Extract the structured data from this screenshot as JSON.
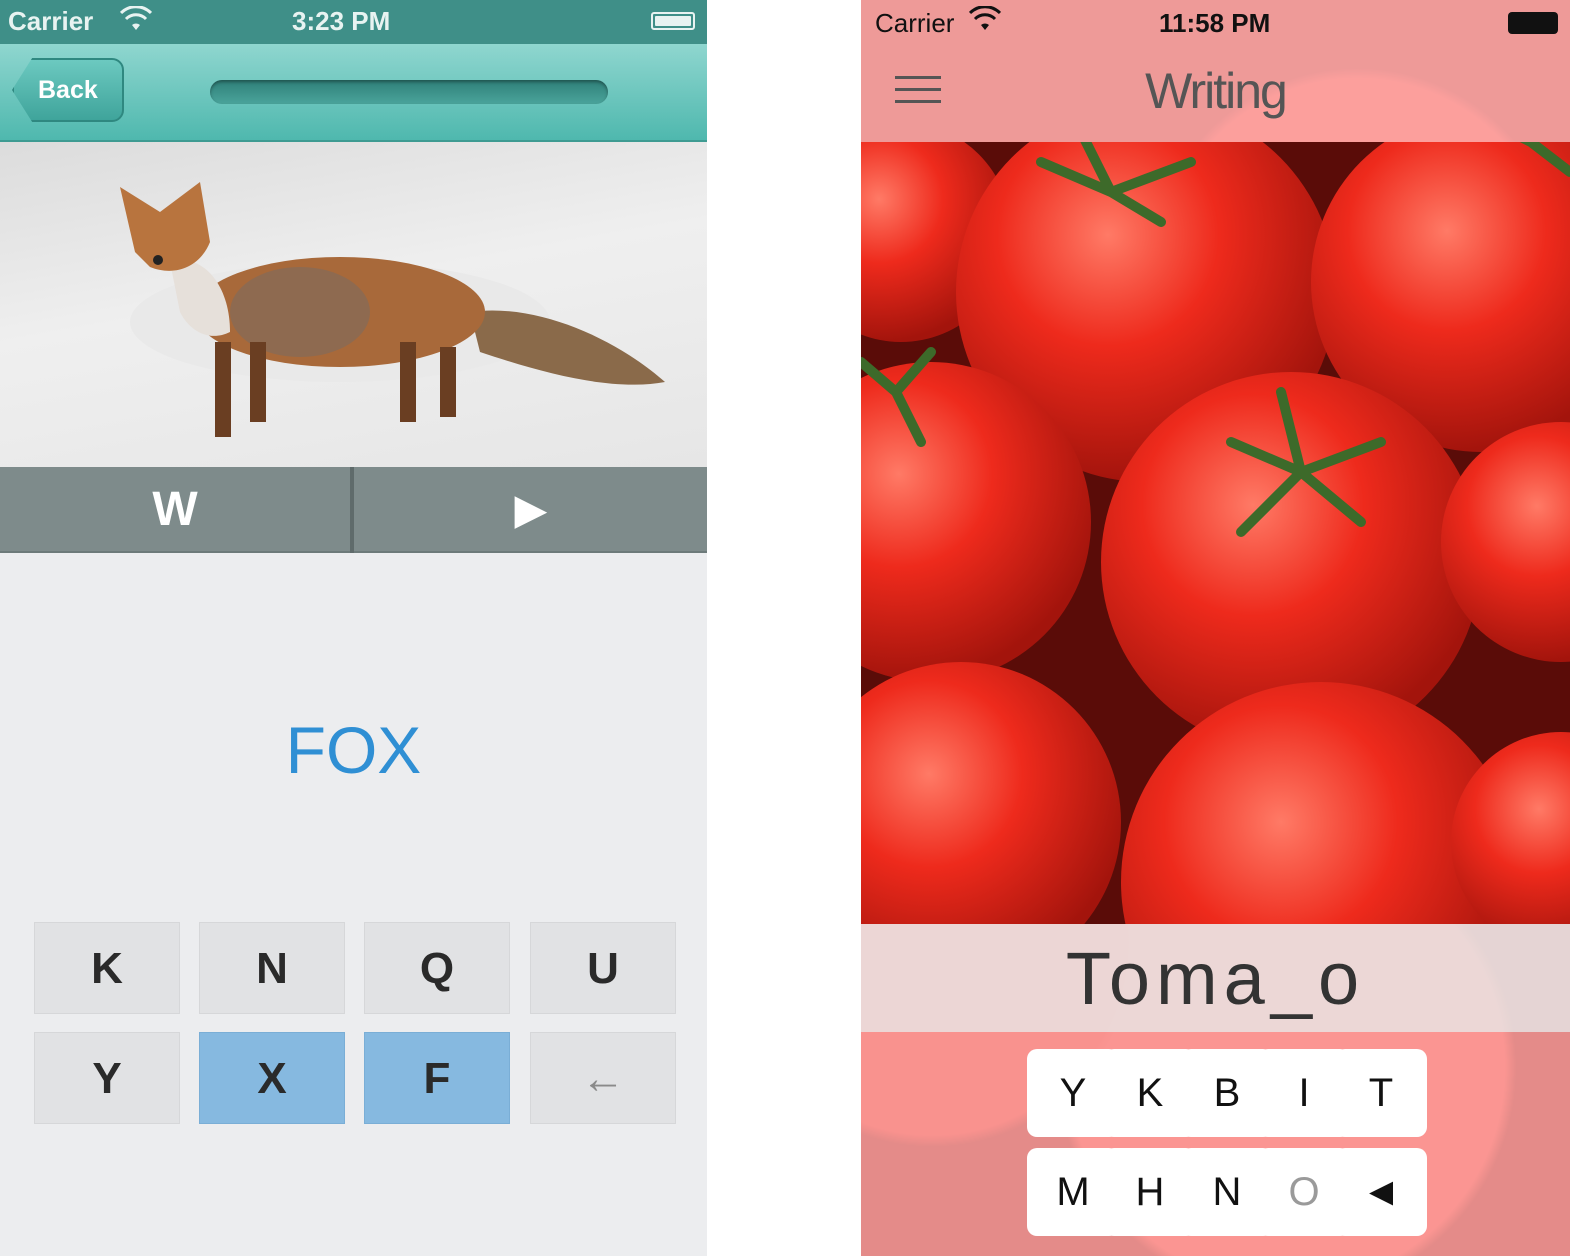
{
  "left_app": {
    "status_bar": {
      "carrier": "Carrier",
      "time": "3:23 PM"
    },
    "nav": {
      "back_label": "Back",
      "progress": 0.0
    },
    "toolbar": {
      "w_label": "W",
      "play_label": "▶"
    },
    "word": "FOX",
    "keys": [
      {
        "label": "K",
        "selected": false
      },
      {
        "label": "N",
        "selected": false
      },
      {
        "label": "Q",
        "selected": false
      },
      {
        "label": "U",
        "selected": false
      },
      {
        "label": "Y",
        "selected": false
      },
      {
        "label": "X",
        "selected": true
      },
      {
        "label": "F",
        "selected": true
      },
      {
        "label": "←",
        "selected": false
      }
    ],
    "colors": {
      "nav": "#4fb8ae",
      "word": "#2f8fd4",
      "key_selected": "#86b9e0"
    }
  },
  "right_app": {
    "status_bar": {
      "carrier": "Carrier",
      "time": "11:58 PM"
    },
    "title": "Writing",
    "word": "Toma_o",
    "keys": [
      {
        "label": "Y",
        "dim": false
      },
      {
        "label": "K",
        "dim": false
      },
      {
        "label": "B",
        "dim": false
      },
      {
        "label": "I",
        "dim": false
      },
      {
        "label": "T",
        "dim": false
      },
      {
        "label": "M",
        "dim": false
      },
      {
        "label": "H",
        "dim": false
      },
      {
        "label": "N",
        "dim": false
      },
      {
        "label": "O",
        "dim": true
      },
      {
        "label": "◄",
        "dim": false
      }
    ]
  },
  "icons": {
    "wifi": "wifi-icon",
    "battery": "battery-icon",
    "menu": "hamburger-menu-icon",
    "play": "play-icon",
    "backspace": "backspace-arrow-icon"
  }
}
